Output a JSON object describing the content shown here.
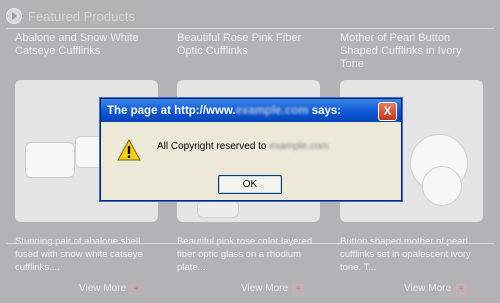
{
  "header": {
    "title": "Featured Products"
  },
  "products": [
    {
      "title": "Abalone and Snow White Catseye Cufflinks",
      "description": "Stunning pair of abalone shell fused with snow white catseye cufflinks....",
      "view_more": "View More"
    },
    {
      "title": "Beautiful Rose Pink Fiber Optic Cufflinks",
      "description": "Beautiful pink rose color layered fiber optic glass on a rhodium plate....",
      "view_more": "View More"
    },
    {
      "title": "Mother of Pearl Button Shaped Cufflinks in Ivory Tone",
      "description": "Button shaped mother of pearl cufflinks set in opalescent ivory tone. T...",
      "view_more": "View More"
    }
  ],
  "dialog": {
    "title_prefix": "The page at http://www.",
    "title_suffix": " says:",
    "message_prefix": "All Copyright reserved to ",
    "ok_label": "OK",
    "close_label": "X"
  }
}
